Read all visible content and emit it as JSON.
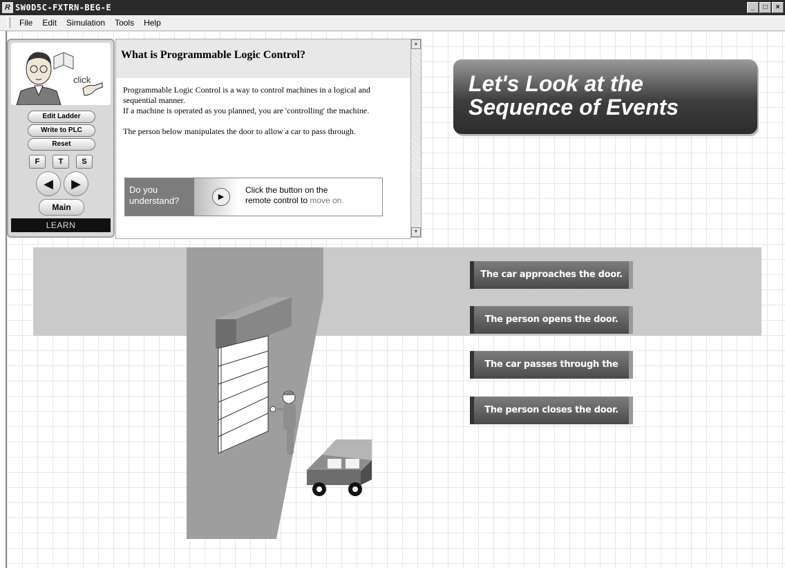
{
  "window": {
    "title": "SW0D5C-FXTRN-BEG-E",
    "icon": "app-icon",
    "controls": [
      "_",
      "□",
      "×"
    ]
  },
  "menu": {
    "items": [
      {
        "label": "File",
        "mnemonic": "F"
      },
      {
        "label": "Edit",
        "mnemonic": "E"
      },
      {
        "label": "Simulation",
        "mnemonic": "S"
      },
      {
        "label": "Tools",
        "mnemonic": "T"
      },
      {
        "label": "Help",
        "mnemonic": "H"
      }
    ]
  },
  "control_panel": {
    "click_label": "click",
    "edit_ladder": "Edit Ladder",
    "write_to_plc": "Write to PLC",
    "reset": "Reset",
    "f": "F",
    "t": "T",
    "s": "S",
    "prev": "◀",
    "next": "▶",
    "main": "Main",
    "mode": "LEARN"
  },
  "lesson": {
    "title": "What is Programmable Logic Control?",
    "para1": "Programmable Logic Control is a way to control machines in a logical and sequential manner.",
    "para2": "If a machine is operated as you planned, you are 'controlling' the machine.",
    "para3": "The person below manipulates the door to allow a car to pass through.",
    "ask_label": "Do you understand?",
    "ask_msg_1": "Click the button on the",
    "ask_msg_2": "remote control to",
    "ask_msg_3": "move on."
  },
  "banner": {
    "line1": "Let's Look at the",
    "line2": "Sequence of Events"
  },
  "steps": [
    "The car approaches the door.",
    "The person opens the door.",
    "The car passes through the door.",
    "The person closes the door."
  ],
  "colors": {
    "titlebar": "#2a2a2a",
    "band": "#cacaca",
    "wall": "#9a9a9a",
    "step_button": "#5a5a5a"
  }
}
